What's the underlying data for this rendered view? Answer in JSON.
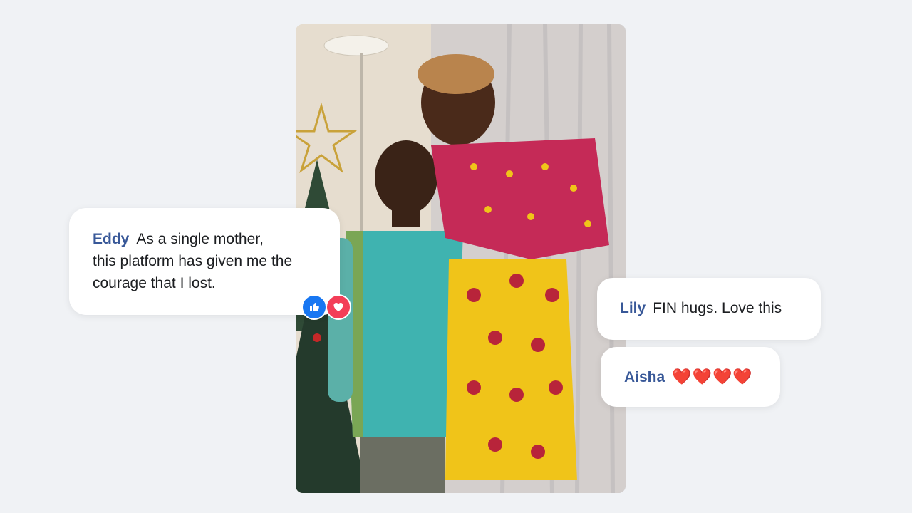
{
  "photo": {
    "icon": "family-photo"
  },
  "comments": [
    {
      "name": "Eddy",
      "text_lines": [
        "As a single mother,",
        "this platform has given me the",
        "courage that I lost."
      ]
    },
    {
      "name": "Lily",
      "text": "FIN hugs. Love this"
    },
    {
      "name": "Aisha",
      "text": "❤️❤️❤️❤️"
    }
  ],
  "reactions": [
    {
      "type": "like",
      "icon": "thumbs-up-icon",
      "color": "#1877f2"
    },
    {
      "type": "love",
      "icon": "heart-icon",
      "color": "#f33e58"
    }
  ],
  "colors": {
    "background": "#f0f2f5",
    "name_color": "#385898"
  }
}
